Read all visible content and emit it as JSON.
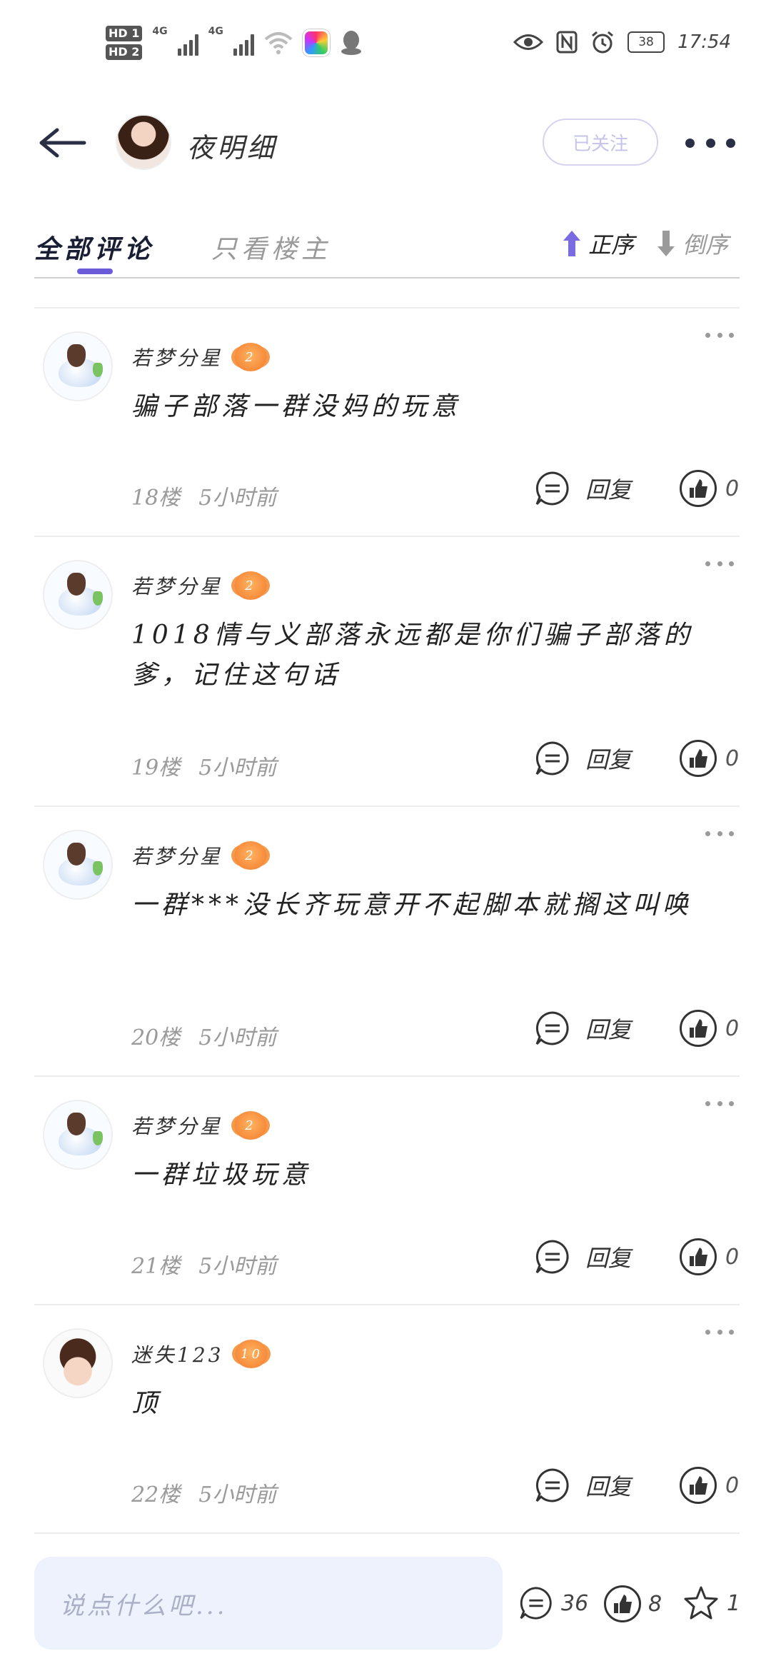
{
  "status_bar": {
    "hd1": "HD 1",
    "hd2": "HD 2",
    "net1": "4G",
    "net2": "4G",
    "battery": "38",
    "time": "17:54"
  },
  "header": {
    "nickname": "夜明细",
    "follow_label": "已关注"
  },
  "tabs": {
    "all_comments": "全部评论",
    "owner_only": "只看楼主",
    "sort_asc": "正序",
    "sort_desc": "倒序"
  },
  "actions": {
    "reply_label": "回复"
  },
  "comments": [
    {
      "user": "若梦分星",
      "level": "2",
      "text": "骗子部落一群没妈的玩意",
      "floor": "18楼",
      "time": "5小时前",
      "likes": "0"
    },
    {
      "user": "若梦分星",
      "level": "2",
      "text": "1018情与义部落永远都是你们骗子部落的爹，记住这句话",
      "floor": "19楼",
      "time": "5小时前",
      "likes": "0"
    },
    {
      "user": "若梦分星",
      "level": "2",
      "text": "一群***没长齐玩意开不起脚本就搁这叫唤",
      "floor": "20楼",
      "time": "5小时前",
      "likes": "0"
    },
    {
      "user": "若梦分星",
      "level": "2",
      "text": "一群垃圾玩意",
      "floor": "21楼",
      "time": "5小时前",
      "likes": "0"
    },
    {
      "user": "迷失123",
      "level": "10",
      "text": "顶",
      "floor": "22楼",
      "time": "5小时前",
      "likes": "0"
    }
  ],
  "bottom_bar": {
    "input_placeholder": "说点什么吧...",
    "comment_count": "36",
    "like_count": "8",
    "fav_count": "1"
  }
}
